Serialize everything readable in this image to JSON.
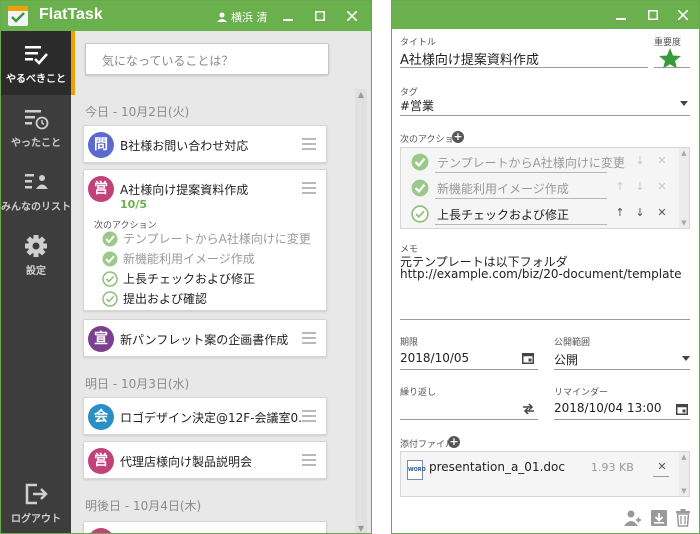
{
  "left_window": {
    "app_name": "FlatTask",
    "user_name": "横浜 清",
    "sidebar": [
      {
        "label": "やるべきこと",
        "icon": "todo-list-check-icon",
        "active": true
      },
      {
        "label": "やったこと",
        "icon": "done-history-icon",
        "active": false
      },
      {
        "label": "みんなのリスト",
        "icon": "team-list-icon",
        "active": false
      },
      {
        "label": "設定",
        "icon": "gear-icon",
        "active": false
      },
      {
        "label": "ログアウト",
        "icon": "logout-icon",
        "active": false
      }
    ],
    "search_placeholder": "気になっていることは？",
    "days": [
      {
        "header": "今日 - 10月2日(火)"
      },
      {
        "header": "明日 - 10月3日(水)"
      },
      {
        "header": "明後日 - 10月4日(木)"
      }
    ],
    "tasks": [
      {
        "badge": "問",
        "color": "#5a6acf",
        "title": "B社様お問い合わせ対応"
      },
      {
        "badge": "営",
        "color": "#c2417a",
        "title": "A社様向け提案資料作成",
        "progress": "10/5",
        "actions_label": "次のアクション",
        "actions": [
          {
            "text": "テンプレートからA社様向けに変更",
            "done": true
          },
          {
            "text": "新機能利用イメージ作成",
            "done": true
          },
          {
            "text": "上長チェックおよび修正",
            "done": false
          },
          {
            "text": "提出および確認",
            "done": false
          }
        ]
      },
      {
        "badge": "宣",
        "color": "#7a3f8f",
        "title": "新パンフレット案の企画書作成"
      },
      {
        "badge": "会",
        "color": "#2a8fc4",
        "title": "ロゴデザイン決定@12F-会議室0..."
      },
      {
        "badge": "営",
        "color": "#c2417a",
        "title": "代理店様向け製品説明会"
      }
    ]
  },
  "right_window": {
    "title_label": "タイトル",
    "title_value": "A社様向け提案資料作成",
    "importance_label": "重要度",
    "tag_label": "タグ",
    "tag_value": "#営業",
    "next_actions_label": "次のアクション",
    "next_actions": [
      {
        "text": "テンプレートからA社様向けに変更",
        "done": true
      },
      {
        "text": "新機能利用イメージ作成",
        "done": true
      },
      {
        "text": "上長チェックおよび修正",
        "done": false
      }
    ],
    "memo_label": "メモ",
    "memo_line1": "元テンプレートは以下フォルダ",
    "memo_line2": "http://example.com/biz/20-document/template",
    "due_label": "期限",
    "due_value": "2018/10/05",
    "scope_label": "公開範囲",
    "scope_value": "公開",
    "repeat_label": "繰り返し",
    "repeat_value": "",
    "reminder_label": "リマインダー",
    "reminder_value": "2018/10/04 13:00",
    "attachments_label": "添付ファイル",
    "attachment_name": "presentation_a_01.doc",
    "attachment_size": "1.93 KB",
    "attachment_icon_text": "WORD"
  },
  "colors": {
    "title_bar": "#6ab04c",
    "sidebar": "#3d3d3d",
    "accent": "#f0a000",
    "check_green": "#8ec07c",
    "star": "#3a9a3a"
  }
}
